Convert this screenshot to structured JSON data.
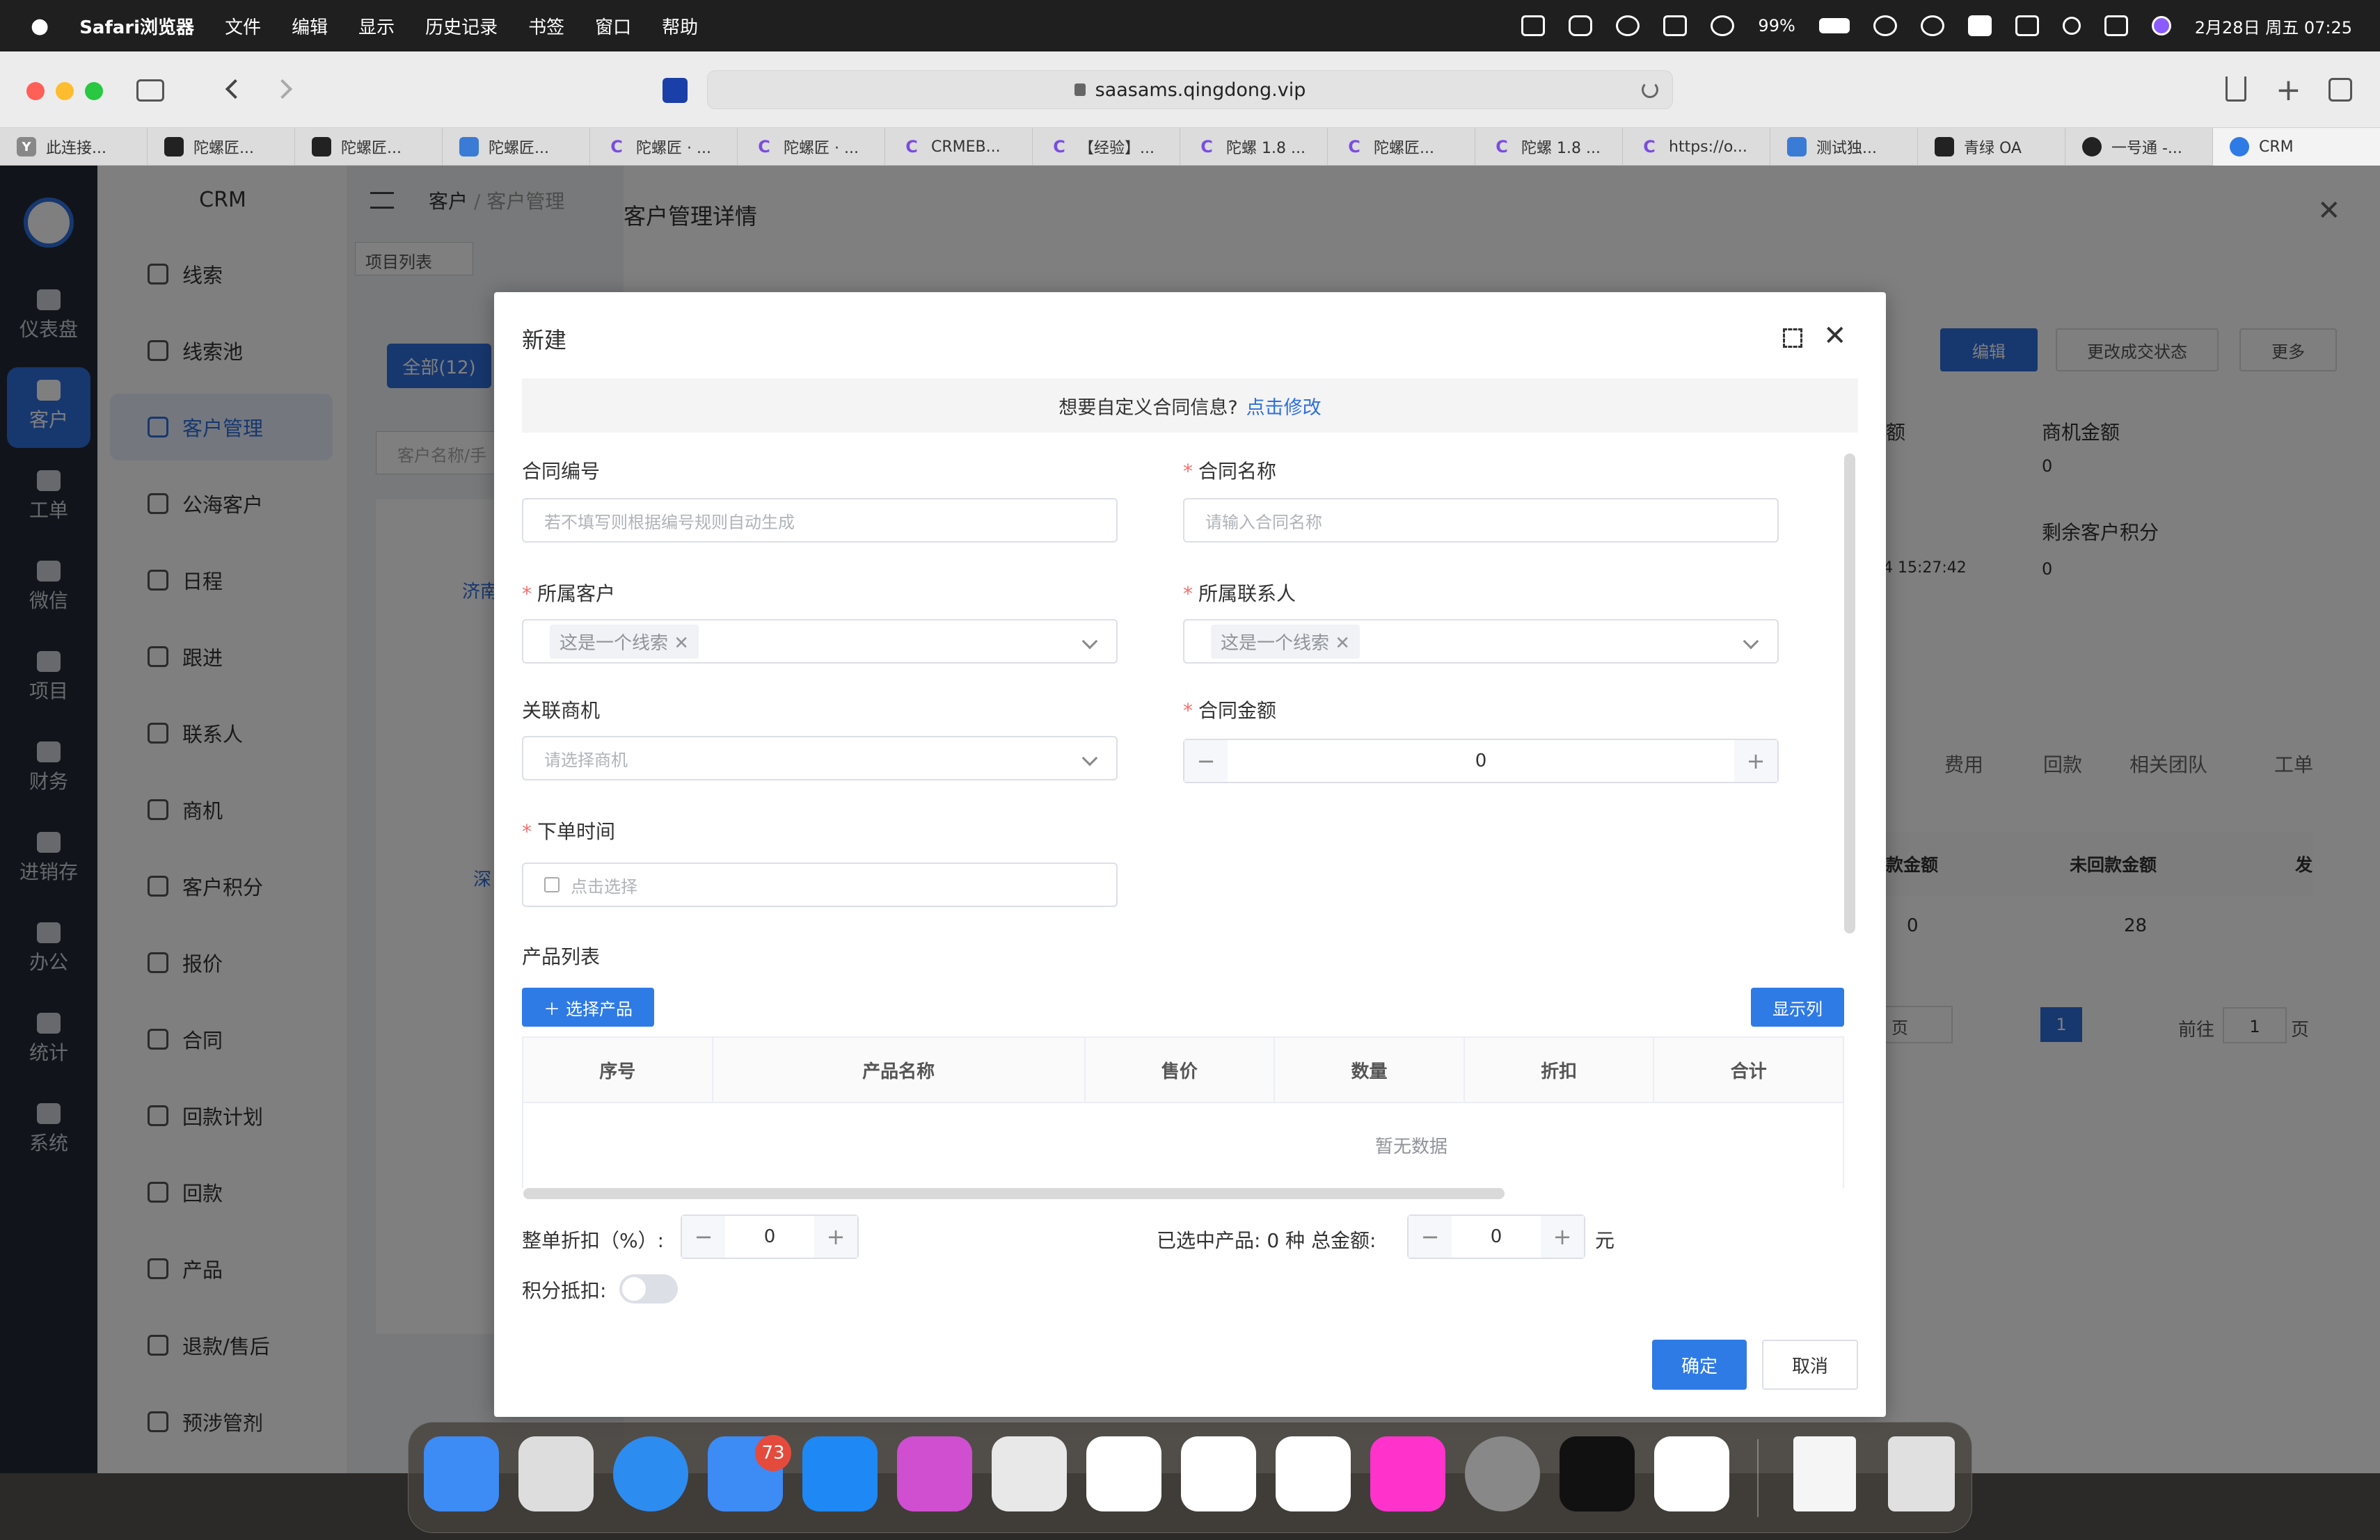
{
  "menubar": {
    "app": "Safari浏览器",
    "items": [
      "文件",
      "编辑",
      "显示",
      "历史记录",
      "书签",
      "窗口",
      "帮助"
    ],
    "battery": "99%",
    "datetime": "2月28日 周五  07:25"
  },
  "browser": {
    "url": "saasams.qingdong.vip",
    "tabs": [
      "此连接...",
      "陀螺匠...",
      "陀螺匠...",
      "陀螺匠...",
      "陀螺匠 · ...",
      "陀螺匠 · ...",
      "CRMEB...",
      "【经验】...",
      "陀螺 1.8 ...",
      "陀螺匠...",
      "陀螺 1.8 ...",
      "https://o...",
      "测试独...",
      "青绿 OA",
      "一号通 -...",
      "CRM"
    ]
  },
  "rail": [
    "仪表盘",
    "客户",
    "工单",
    "微信",
    "项目",
    "财务",
    "进销存",
    "办公",
    "统计",
    "系统"
  ],
  "submenu": {
    "title": "CRM",
    "items": [
      "线索",
      "线索池",
      "客户管理",
      "公海客户",
      "日程",
      "跟进",
      "联系人",
      "商机",
      "客户积分",
      "报价",
      "合同",
      "回款计划",
      "回款",
      "产品",
      "退款/售后",
      "预涉管剂"
    ]
  },
  "background": {
    "breadcrumb1": "客户",
    "breadcrumb2": "客户管理",
    "tab": "项目列表",
    "filter": "全部(12)",
    "search_ph": "客户名称/手",
    "detail_title": "客户管理详情",
    "edit": "编辑",
    "change_status": "更改成交状态",
    "more": "更多",
    "biz_amount_label": "商机金额",
    "biz_amount": "0",
    "points_label": "剩余客户积分",
    "points": "0",
    "time": "4 15:27:42",
    "amount_partial": "额",
    "tabs": [
      "费用",
      "回款",
      "相关团队",
      "工单"
    ],
    "col1": "款金额",
    "col2": "未回款金额",
    "col3": "发",
    "v1": "0",
    "v2": "28",
    "page_prefix": "页",
    "goto": "前往",
    "page": "1",
    "page_suffix": "页",
    "row1": "济南",
    "row2": "深"
  },
  "dialog": {
    "title": "新建",
    "tip": "想要自定义合同信息?",
    "tip_link": "点击修改",
    "contract_no": {
      "label": "合同编号",
      "placeholder": "若不填写则根据编号规则自动生成"
    },
    "contract_name": {
      "label": "合同名称",
      "placeholder": "请输入合同名称"
    },
    "customer": {
      "label": "所属客户",
      "value": "这是一个线索"
    },
    "contact": {
      "label": "所属联系人",
      "value": "这是一个线索"
    },
    "opportunity": {
      "label": "关联商机",
      "placeholder": "请选择商机"
    },
    "amount": {
      "label": "合同金额",
      "value": "0"
    },
    "order_time": {
      "label": "下单时间",
      "placeholder": "点击选择"
    },
    "product_list": "产品列表",
    "select_product": "选择产品",
    "show_columns": "显示列",
    "columns": [
      "序号",
      "产品名称",
      "售价",
      "数量",
      "折扣",
      "合计"
    ],
    "empty": "暂无数据",
    "discount_label": "整单折扣（%）:",
    "discount_value": "0",
    "selected_label": "已选中产品:",
    "selected_count": "0 种",
    "total_label": "总金额:",
    "total_value": "0",
    "unit": "元",
    "points_label": "积分抵扣:",
    "ok": "确定",
    "cancel": "取消"
  },
  "dock_badge": "73"
}
